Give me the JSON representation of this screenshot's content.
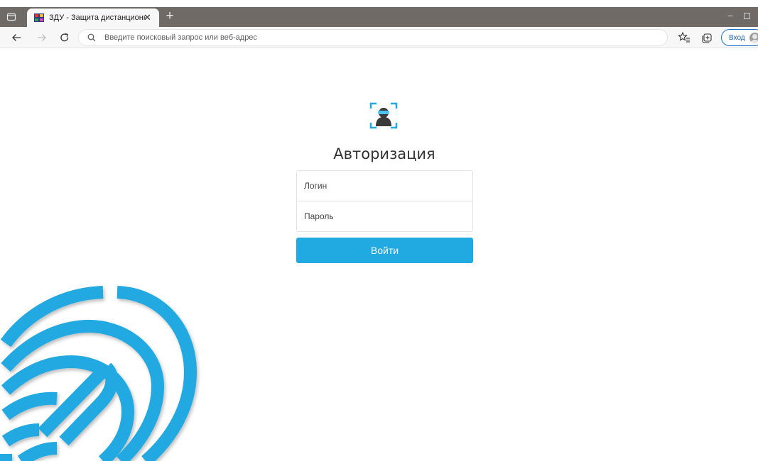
{
  "browser": {
    "tab": {
      "title": "ЗДУ - Защита дистанционного"
    },
    "address": {
      "placeholder": "Введите поисковый запрос или веб-адрес"
    },
    "signin": {
      "label": "Вход"
    }
  },
  "login": {
    "title": "Авторизация",
    "login_placeholder": "Логин",
    "password_placeholder": "Пароль",
    "submit_label": "Войти"
  },
  "colors": {
    "accent": "#21a9e1",
    "tabstrip": "#6f6a66",
    "toolbar": "#f7f7f7"
  }
}
